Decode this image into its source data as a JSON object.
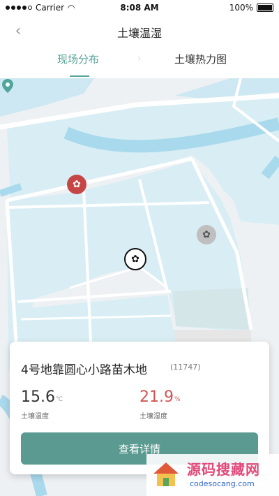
{
  "status_bar": {
    "carrier": "Carrier",
    "time": "8:08 AM",
    "battery": "100%"
  },
  "nav": {
    "back_icon": "back-chevron-icon",
    "title": "土壤温湿"
  },
  "tabs": [
    {
      "label": "现场分布",
      "active": true
    },
    {
      "label": "土壤热力图",
      "active": false
    }
  ],
  "map": {
    "markers": [
      {
        "name": "plant-marker-red",
        "icon": "plant-icon",
        "color": "#c64545"
      },
      {
        "name": "plant-marker-black",
        "icon": "plant-icon",
        "color": "#111111"
      },
      {
        "name": "plant-marker-gray",
        "icon": "plant-icon",
        "color": "#bfbfbf"
      }
    ],
    "location_pin": {
      "icon": "location-pin-icon",
      "color": "#4fa59b"
    }
  },
  "card": {
    "title": "4号地靠圆心小路苗木地",
    "id": "(11747)",
    "temperature": {
      "value": "15.6",
      "unit": "℃",
      "label": "土壤温度"
    },
    "humidity": {
      "value": "21.9",
      "unit": "%",
      "label": "土壤湿度"
    },
    "button_label": "查看详情"
  },
  "watermark": {
    "main": "源码搜藏网",
    "sub": "codesocang.com"
  },
  "colors": {
    "accent": "#5aa39a",
    "button": "#5a9a90",
    "humidity": "#d05555"
  }
}
